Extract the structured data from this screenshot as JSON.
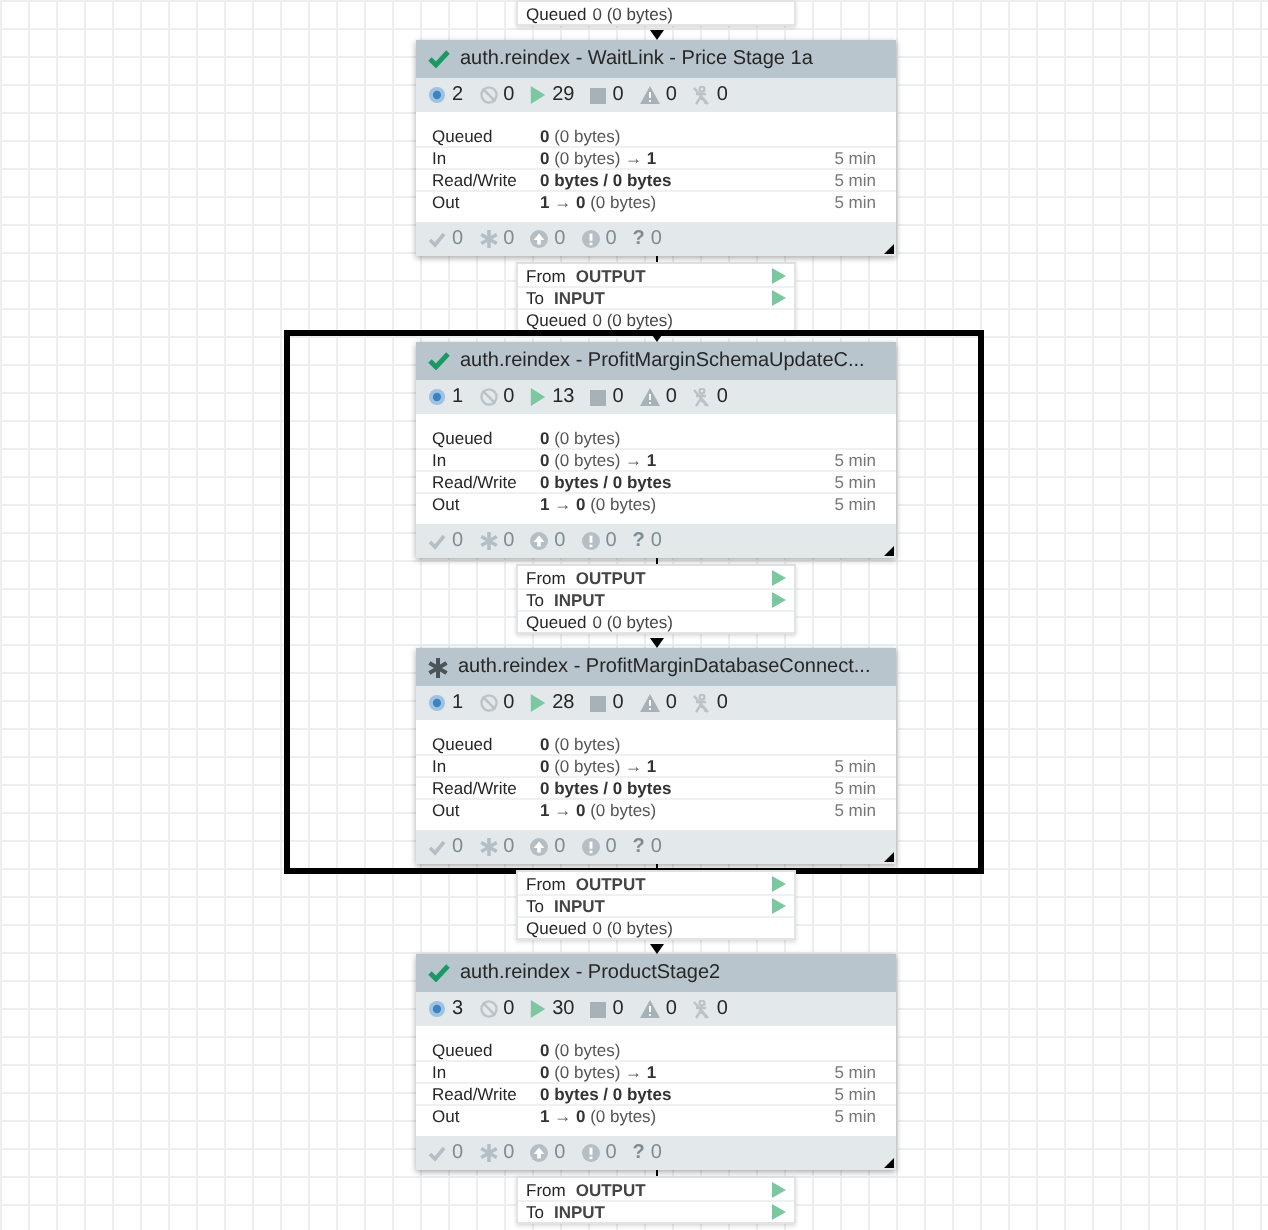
{
  "canvas": {
    "items": [
      {
        "kind": "connection",
        "rows": [
          {
            "kind": "queued",
            "label": "Queued",
            "value": "0 (0 bytes)"
          }
        ]
      },
      {
        "kind": "group",
        "status": {
          "kind": "up_to_date"
        },
        "title": "auth.reindex - WaitLink - Price Stage 1a",
        "stats": [
          {
            "kind": "active_ports",
            "value": "2"
          },
          {
            "kind": "inactive_ports",
            "value": "0"
          },
          {
            "kind": "running",
            "value": "29"
          },
          {
            "kind": "stopped",
            "value": "0"
          },
          {
            "kind": "invalid",
            "value": "0"
          },
          {
            "kind": "disabled",
            "value": "0"
          }
        ],
        "rows": [
          {
            "label": "Queued",
            "value": "**0** (0 bytes)"
          },
          {
            "label": "In",
            "value": "**0** (0 bytes) → **1**",
            "time": "5 min"
          },
          {
            "label": "Read/Write",
            "value": "**0 bytes / 0 bytes**",
            "time": "5 min"
          },
          {
            "label": "Out",
            "value": "**1** → **0** (0 bytes)",
            "time": "5 min"
          }
        ],
        "versions": [
          {
            "kind": "up_to_date",
            "value": "0"
          },
          {
            "kind": "locally_modified",
            "value": "0"
          },
          {
            "kind": "stale",
            "value": "0"
          },
          {
            "kind": "modified_stale",
            "value": "0"
          },
          {
            "kind": "sync_failure",
            "symbol": "?",
            "value": "0"
          }
        ]
      },
      {
        "kind": "connection",
        "rows": [
          {
            "kind": "from",
            "label": "From",
            "value": "OUTPUT"
          },
          {
            "kind": "to",
            "label": "To",
            "value": "INPUT"
          },
          {
            "kind": "queued",
            "label": "Queued",
            "value": "0 (0 bytes)"
          }
        ]
      },
      {
        "kind": "highlight",
        "items": [
          {
            "kind": "group",
            "status": {
              "kind": "up_to_date"
            },
            "title": "auth.reindex - ProfitMarginSchemaUpdateC...",
            "stats": [
              {
                "kind": "active_ports",
                "value": "1"
              },
              {
                "kind": "inactive_ports",
                "value": "0"
              },
              {
                "kind": "running",
                "value": "13"
              },
              {
                "kind": "stopped",
                "value": "0"
              },
              {
                "kind": "invalid",
                "value": "0"
              },
              {
                "kind": "disabled",
                "value": "0"
              }
            ],
            "rows": [
              {
                "label": "Queued",
                "value": "**0** (0 bytes)"
              },
              {
                "label": "In",
                "value": "**0** (0 bytes) → **1**",
                "time": "5 min"
              },
              {
                "label": "Read/Write",
                "value": "**0 bytes / 0 bytes**",
                "time": "5 min"
              },
              {
                "label": "Out",
                "value": "**1** → **0** (0 bytes)",
                "time": "5 min"
              }
            ],
            "versions": [
              {
                "kind": "up_to_date",
                "value": "0"
              },
              {
                "kind": "locally_modified",
                "value": "0"
              },
              {
                "kind": "stale",
                "value": "0"
              },
              {
                "kind": "modified_stale",
                "value": "0"
              },
              {
                "kind": "sync_failure",
                "symbol": "?",
                "value": "0"
              }
            ]
          },
          {
            "kind": "connection",
            "rows": [
              {
                "kind": "from",
                "label": "From",
                "value": "OUTPUT"
              },
              {
                "kind": "to",
                "label": "To",
                "value": "INPUT"
              },
              {
                "kind": "queued",
                "label": "Queued",
                "value": "0 (0 bytes)"
              }
            ]
          },
          {
            "kind": "group",
            "status": {
              "kind": "locally_modified"
            },
            "title": "auth.reindex - ProfitMarginDatabaseConnect...",
            "stats": [
              {
                "kind": "active_ports",
                "value": "1"
              },
              {
                "kind": "inactive_ports",
                "value": "0"
              },
              {
                "kind": "running",
                "value": "28"
              },
              {
                "kind": "stopped",
                "value": "0"
              },
              {
                "kind": "invalid",
                "value": "0"
              },
              {
                "kind": "disabled",
                "value": "0"
              }
            ],
            "rows": [
              {
                "label": "Queued",
                "value": "**0** (0 bytes)"
              },
              {
                "label": "In",
                "value": "**0** (0 bytes) → **1**",
                "time": "5 min"
              },
              {
                "label": "Read/Write",
                "value": "**0 bytes / 0 bytes**",
                "time": "5 min"
              },
              {
                "label": "Out",
                "value": "**1** → **0** (0 bytes)",
                "time": "5 min"
              }
            ],
            "versions": [
              {
                "kind": "up_to_date",
                "value": "0"
              },
              {
                "kind": "locally_modified",
                "value": "0"
              },
              {
                "kind": "stale",
                "value": "0"
              },
              {
                "kind": "modified_stale",
                "value": "0"
              },
              {
                "kind": "sync_failure",
                "symbol": "?",
                "value": "0"
              }
            ]
          }
        ]
      },
      {
        "kind": "connection",
        "rows": [
          {
            "kind": "from",
            "label": "From",
            "value": "OUTPUT"
          },
          {
            "kind": "to",
            "label": "To",
            "value": "INPUT"
          },
          {
            "kind": "queued",
            "label": "Queued",
            "value": "0 (0 bytes)"
          }
        ]
      },
      {
        "kind": "group",
        "status": {
          "kind": "up_to_date"
        },
        "title": "auth.reindex - ProductStage2",
        "stats": [
          {
            "kind": "active_ports",
            "value": "3"
          },
          {
            "kind": "inactive_ports",
            "value": "0"
          },
          {
            "kind": "running",
            "value": "30"
          },
          {
            "kind": "stopped",
            "value": "0"
          },
          {
            "kind": "invalid",
            "value": "0"
          },
          {
            "kind": "disabled",
            "value": "0"
          }
        ],
        "rows": [
          {
            "label": "Queued",
            "value": "**0** (0 bytes)"
          },
          {
            "label": "In",
            "value": "**0** (0 bytes) → **1**",
            "time": "5 min"
          },
          {
            "label": "Read/Write",
            "value": "**0 bytes / 0 bytes**",
            "time": "5 min"
          },
          {
            "label": "Out",
            "value": "**1** → **0** (0 bytes)",
            "time": "5 min"
          }
        ],
        "versions": [
          {
            "kind": "up_to_date",
            "value": "0"
          },
          {
            "kind": "locally_modified",
            "value": "0"
          },
          {
            "kind": "stale",
            "value": "0"
          },
          {
            "kind": "modified_stale",
            "value": "0"
          },
          {
            "kind": "sync_failure",
            "symbol": "?",
            "value": "0"
          }
        ]
      },
      {
        "kind": "connection",
        "rows": [
          {
            "kind": "from",
            "label": "From",
            "value": "OUTPUT"
          },
          {
            "kind": "to",
            "label": "To",
            "value": "INPUT"
          }
        ]
      }
    ]
  }
}
